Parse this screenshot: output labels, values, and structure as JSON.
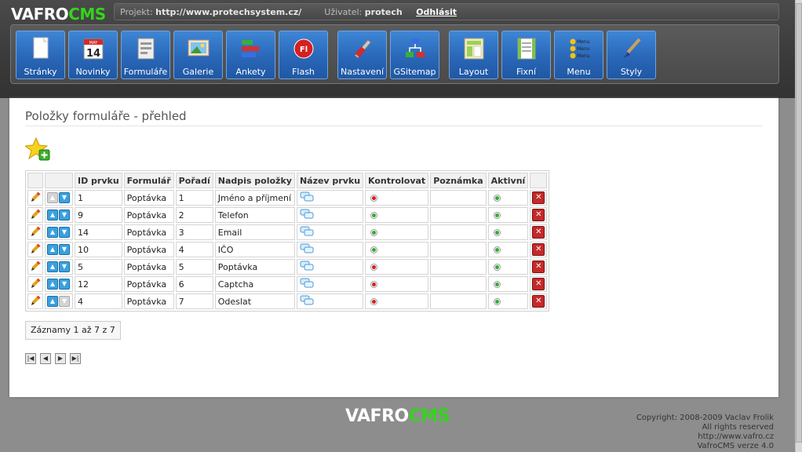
{
  "brand": {
    "part1": "VAFRO",
    "part2": "CMS"
  },
  "infobar": {
    "project_label": "Projekt:",
    "project_url": "http://www.protechsystem.cz/",
    "user_label": "Uživatel:",
    "user_name": "protech",
    "logout": "Odhlásit"
  },
  "toolbar": {
    "items": [
      {
        "label": "Stránky",
        "icon": "page-icon"
      },
      {
        "label": "Novinky",
        "icon": "calendar-icon",
        "badge": "14",
        "badge_top": "MAY"
      },
      {
        "label": "Formuláře",
        "icon": "form-icon"
      },
      {
        "label": "Galerie",
        "icon": "gallery-icon"
      },
      {
        "label": "Ankety",
        "icon": "poll-icon"
      },
      {
        "label": "Flash",
        "icon": "flash-icon",
        "badge": "Fl"
      },
      {
        "label": "Nastavení",
        "icon": "settings-icon"
      },
      {
        "label": "GSitemap",
        "icon": "sitemap-icon"
      },
      {
        "label": "Layout",
        "icon": "layout-icon"
      },
      {
        "label": "Fixní",
        "icon": "fixed-icon"
      },
      {
        "label": "Menu",
        "icon": "menu-icon",
        "menu_word": "Menu"
      },
      {
        "label": "Styly",
        "icon": "brush-icon"
      }
    ]
  },
  "page": {
    "title": "Položky formuláře - přehled"
  },
  "table": {
    "headers": [
      "ID prvku",
      "Formulář",
      "Pořadí",
      "Nadpis položky",
      "Název prvku",
      "Kontrolovat",
      "Poznámka",
      "Aktivní"
    ],
    "rows": [
      {
        "id": "1",
        "form": "Poptávka",
        "order": "1",
        "caption": "Jméno a příjmení",
        "check": "red",
        "active": "green",
        "up": false,
        "down": true
      },
      {
        "id": "9",
        "form": "Poptávka",
        "order": "2",
        "caption": "Telefon",
        "check": "green",
        "active": "green",
        "up": true,
        "down": true
      },
      {
        "id": "14",
        "form": "Poptávka",
        "order": "3",
        "caption": "Email",
        "check": "green",
        "active": "green",
        "up": true,
        "down": true
      },
      {
        "id": "10",
        "form": "Poptávka",
        "order": "4",
        "caption": "IČO",
        "check": "green",
        "active": "green",
        "up": true,
        "down": true
      },
      {
        "id": "5",
        "form": "Poptávka",
        "order": "5",
        "caption": "Poptávka",
        "check": "red",
        "active": "green",
        "up": true,
        "down": true
      },
      {
        "id": "12",
        "form": "Poptávka",
        "order": "6",
        "caption": "Captcha",
        "check": "red",
        "active": "green",
        "up": true,
        "down": true
      },
      {
        "id": "4",
        "form": "Poptávka",
        "order": "7",
        "caption": "Odeslat",
        "check": "red",
        "active": "green",
        "up": true,
        "down": false
      }
    ]
  },
  "records": "Záznamy 1 až 7 z 7",
  "footer": {
    "copyright": [
      "Copyright: 2008-2009 Vaclav Frolik",
      "All rights reserved",
      "http://www.vafro.cz",
      "VafroCMS verze 4.0"
    ]
  },
  "colors": {
    "accent": "#34d41c",
    "button": "#2a67b8",
    "red_dot": "#d32020",
    "green_dot": "#2fae2f"
  }
}
